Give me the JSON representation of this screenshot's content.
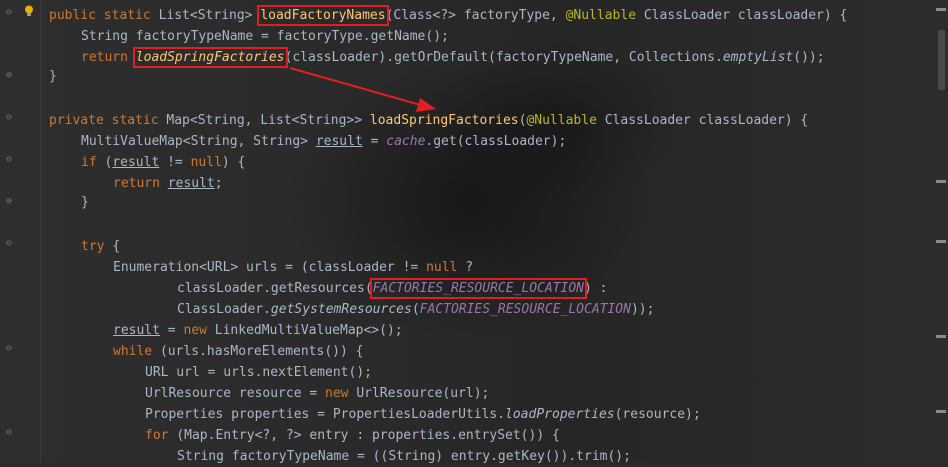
{
  "colors": {
    "keyword": "#cc7832",
    "method": "#ffc66d",
    "annotation": "#bbb529",
    "constant": "#9876aa",
    "text": "#a9b7c6",
    "highlight_box": "#e02020"
  },
  "icons": [
    "lightbulb-icon",
    "fold-marker-icon",
    "annotation-arrow"
  ],
  "lines": [
    {
      "t0": "public static ",
      "t1": "List<String> ",
      "fn": "loadFactoryNames",
      "t2": "(Class<?> factoryType, ",
      "an": "@Nullable",
      "t3": " ClassLoader classLoader) {"
    },
    {
      "t0": "String factoryTypeName = factoryType.getName();"
    },
    {
      "kw": "return ",
      "fn": "loadSpringFactories",
      "t1": "(classLoader).getOrDefault(factoryTypeName, Collections.",
      "st": "emptyList",
      "t2": "());"
    },
    {
      "t0": "}"
    },
    {
      "kw": "private static ",
      "t0": "Map<String, List<String>> ",
      "fn": "loadSpringFactories",
      "t1": "(",
      "an": "@Nullable",
      "t2": " ClassLoader classLoader) {"
    },
    {
      "t0": "MultiValueMap<String, String> ",
      "ul": "result",
      "t1": " = ",
      "co": "cache",
      "t2": ".get(classLoader);"
    },
    {
      "kw": "if ",
      "t0": "(",
      "ul": "result",
      "t1": " != ",
      "kw2": "null",
      "t2": ") {"
    },
    {
      "kw": "return ",
      "ul": "result",
      "t0": ";"
    },
    {
      "t0": "}"
    },
    {
      "kw": "try ",
      "t0": "{"
    },
    {
      "t0": "Enumeration<URL> urls = (classLoader != ",
      "kw": "null ",
      "t1": "?"
    },
    {
      "t0": "classLoader.getResources(",
      "co": "FACTORIES_RESOURCE_LOCATION",
      "t1": ") :"
    },
    {
      "t0": "ClassLoader.",
      "st": "getSystemResources",
      "t1": "(",
      "co": "FACTORIES_RESOURCE_LOCATION",
      "t2": "));"
    },
    {
      "ul": "result",
      "t0": " = ",
      "kw": "new ",
      "t1": "LinkedMultiValueMap<>();"
    },
    {
      "kw": "while ",
      "t0": "(urls.hasMoreElements()) {"
    },
    {
      "t0": "URL url = urls.nextElement();"
    },
    {
      "t0": "UrlResource resource = ",
      "kw": "new ",
      "t1": "UrlResource(url);"
    },
    {
      "t0": "Properties properties = PropertiesLoaderUtils.",
      "st": "loadProperties",
      "t1": "(resource);"
    },
    {
      "kw": "for ",
      "t0": "(Map.Entry<?, ?> entry : properties.entrySet()) {"
    },
    {
      "t0": "String factoryTypeName = ((String) entry.getKey()).trim();"
    }
  ]
}
